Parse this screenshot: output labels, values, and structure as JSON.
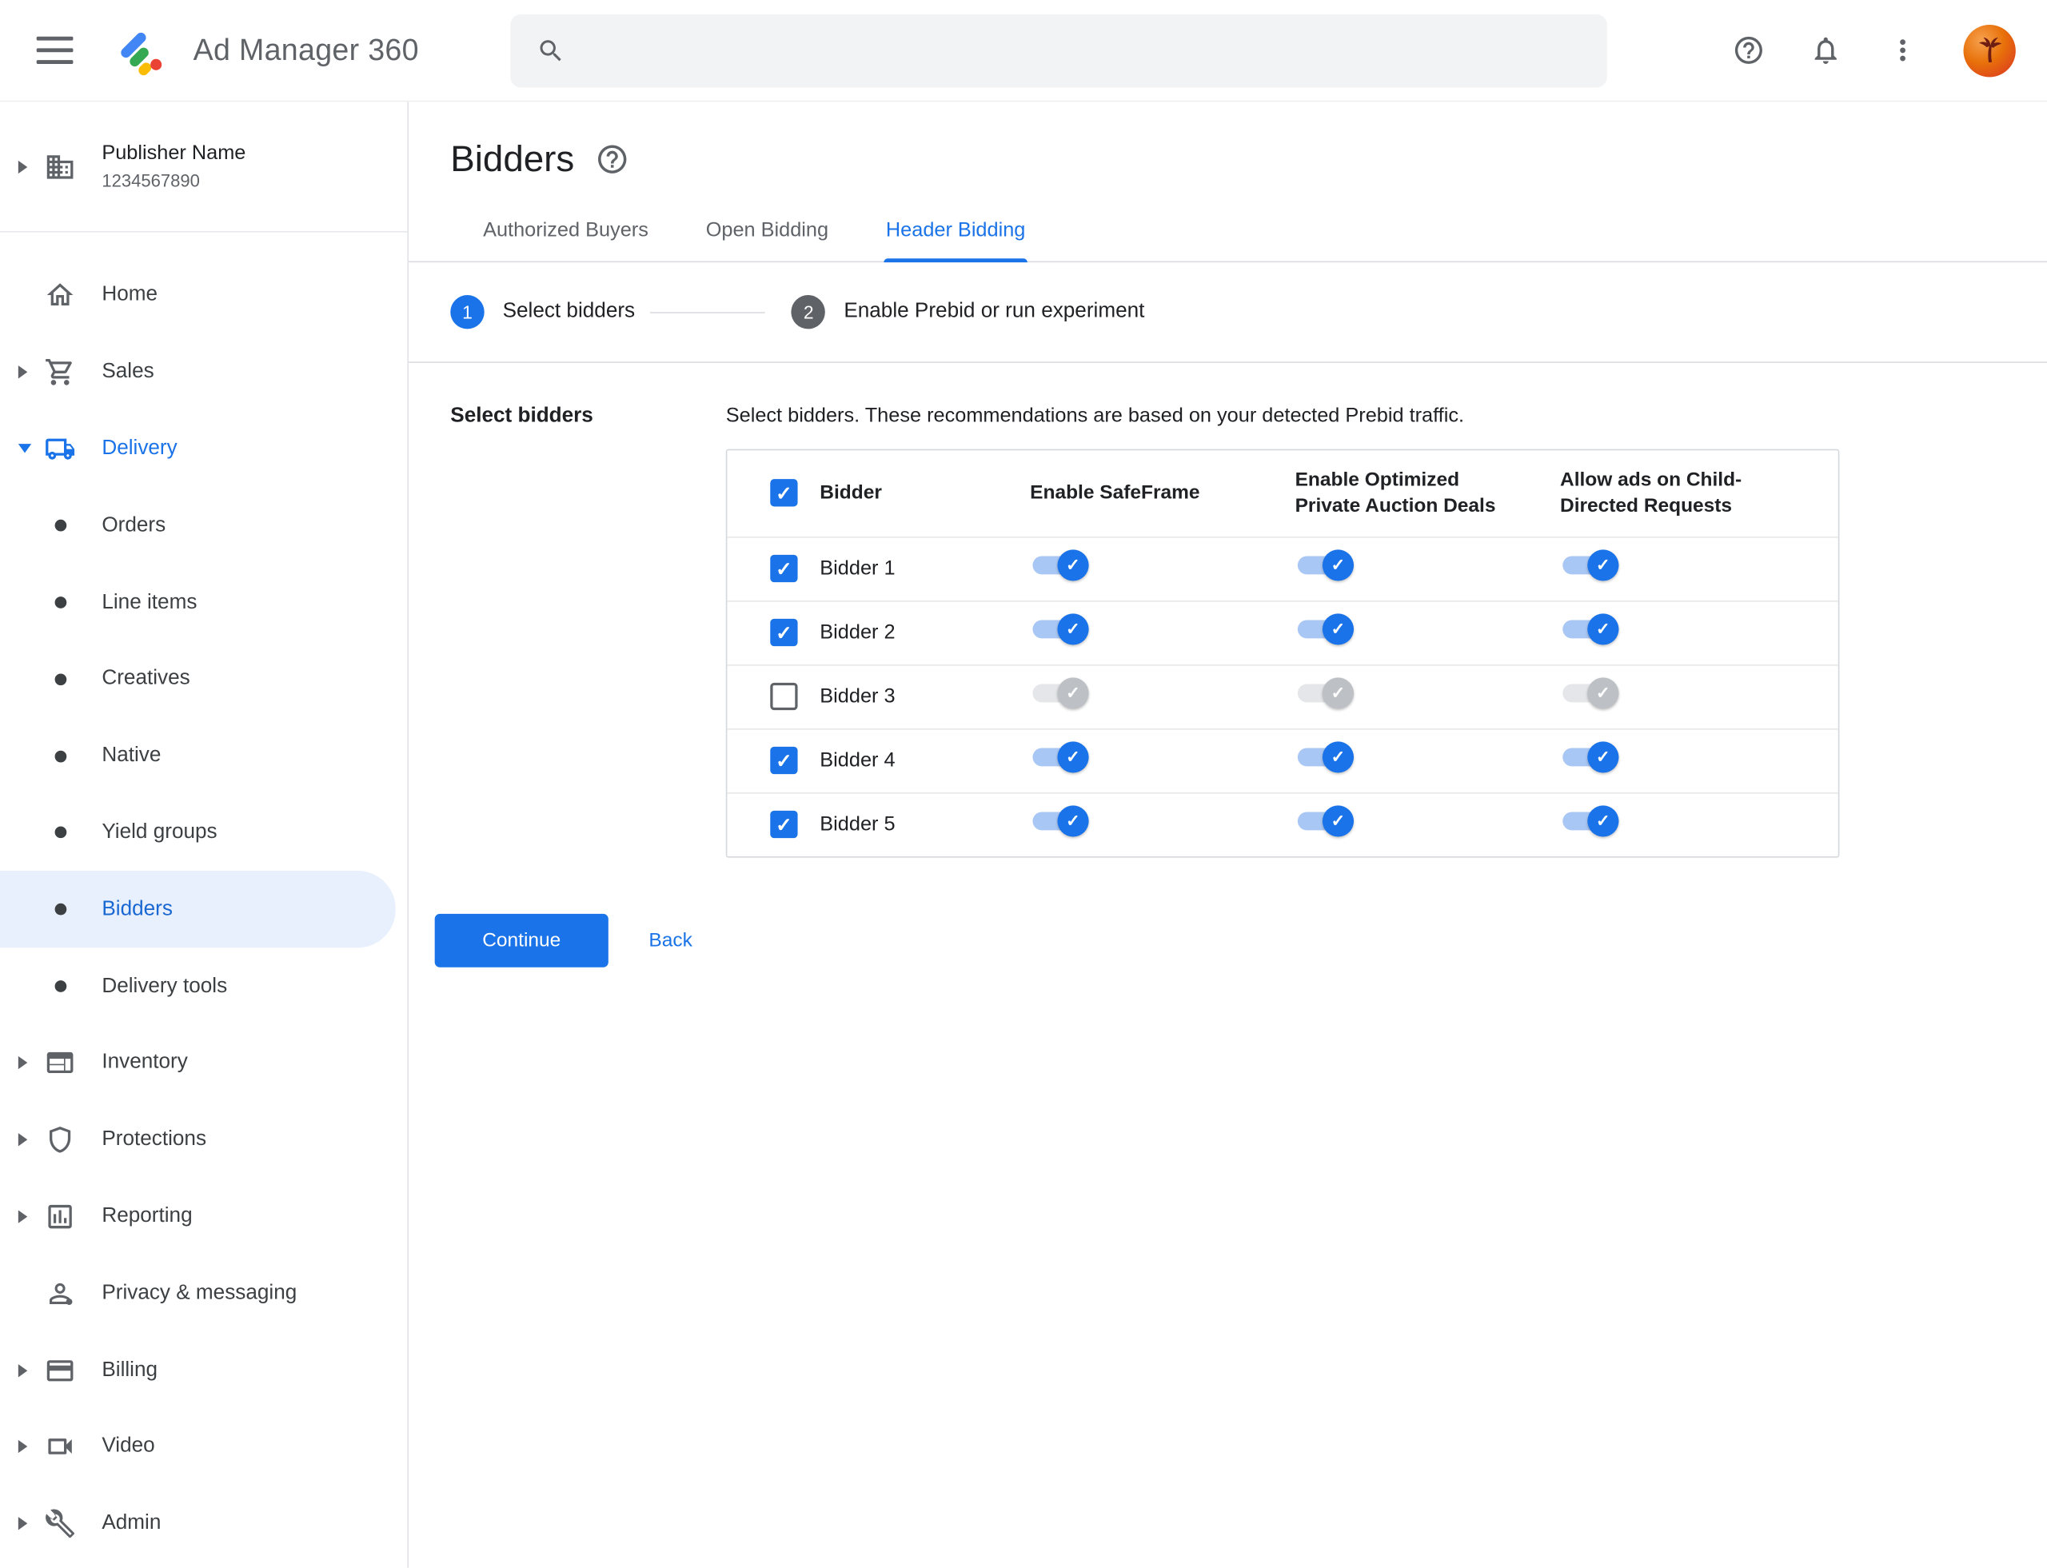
{
  "topbar": {
    "app_name": "Ad Manager 360",
    "search_placeholder": "",
    "icons": [
      "menu-icon",
      "ad-manager-logo",
      "search-icon",
      "help-icon",
      "notifications-icon",
      "more-options-icon",
      "avatar"
    ]
  },
  "sidebar": {
    "publisher": {
      "name": "Publisher Name",
      "id": "1234567890",
      "icon": "building-icon"
    },
    "items": [
      {
        "label": "Home",
        "icon": "home-icon"
      },
      {
        "label": "Sales",
        "icon": "cart-icon",
        "collapsible": true
      },
      {
        "label": "Delivery",
        "icon": "truck-icon",
        "collapsible": true,
        "expanded": true
      },
      {
        "label": "Orders",
        "sub": true
      },
      {
        "label": "Line items",
        "sub": true
      },
      {
        "label": "Creatives",
        "sub": true
      },
      {
        "label": "Native",
        "sub": true
      },
      {
        "label": "Yield groups",
        "sub": true
      },
      {
        "label": "Bidders",
        "sub": true,
        "active": true
      },
      {
        "label": "Delivery tools",
        "sub": true
      },
      {
        "label": "Inventory",
        "icon": "inventory-icon",
        "collapsible": true
      },
      {
        "label": "Protections",
        "icon": "shield-icon",
        "collapsible": true
      },
      {
        "label": "Reporting",
        "icon": "report-chart-icon",
        "collapsible": true
      },
      {
        "label": "Privacy & messaging",
        "icon": "person-icon"
      },
      {
        "label": "Billing",
        "icon": "billing-card-icon",
        "collapsible": true
      },
      {
        "label": "Video",
        "icon": "video-camera-icon",
        "collapsible": true
      },
      {
        "label": "Admin",
        "icon": "wrench-icon",
        "collapsible": true
      }
    ]
  },
  "main": {
    "title": "Bidders",
    "title_icon": "help-icon",
    "tabs": [
      {
        "label": "Authorized Buyers",
        "active": false
      },
      {
        "label": "Open Bidding",
        "active": false
      },
      {
        "label": "Header Bidding",
        "active": true
      }
    ],
    "stepper": [
      {
        "number": "1",
        "label": "Select bidders",
        "state": "current"
      },
      {
        "number": "2",
        "label": "Enable Prebid or run experiment",
        "state": "upcoming"
      }
    ],
    "section_label": "Select bidders",
    "description": "Select bidders. These recommendations are based on your detected Prebid traffic.",
    "table": {
      "header_checkbox_checked": true,
      "columns": [
        "Bidder",
        "Enable SafeFrame",
        "Enable Optimized Private Auction Deals",
        "Allow ads on Child-Directed Requests"
      ],
      "rows": [
        {
          "name": "Bidder 1",
          "checked": true,
          "safeframe": true,
          "optimized": true,
          "child_directed": true
        },
        {
          "name": "Bidder 2",
          "checked": true,
          "safeframe": true,
          "optimized": true,
          "child_directed": true
        },
        {
          "name": "Bidder 3",
          "checked": false,
          "safeframe": false,
          "optimized": false,
          "child_directed": false
        },
        {
          "name": "Bidder 4",
          "checked": true,
          "safeframe": true,
          "optimized": true,
          "child_directed": true
        },
        {
          "name": "Bidder 5",
          "checked": true,
          "safeframe": true,
          "optimized": true,
          "child_directed": true
        }
      ]
    },
    "continue_label": "Continue",
    "back_label": "Back"
  },
  "colors": {
    "accent_blue": "#1a73e8",
    "active_nav_bg": "#e8f0fe",
    "active_nav_text": "#1967d2",
    "toggle_track_on": "#a9c7f4",
    "toggle_thumb_on": "#1a73e8",
    "toggle_track_off": "#e4e6e9",
    "toggle_thumb_off": "#bdc1c6",
    "text_primary": "#202124",
    "text_secondary": "#5f6368",
    "divider": "#dadce0"
  }
}
